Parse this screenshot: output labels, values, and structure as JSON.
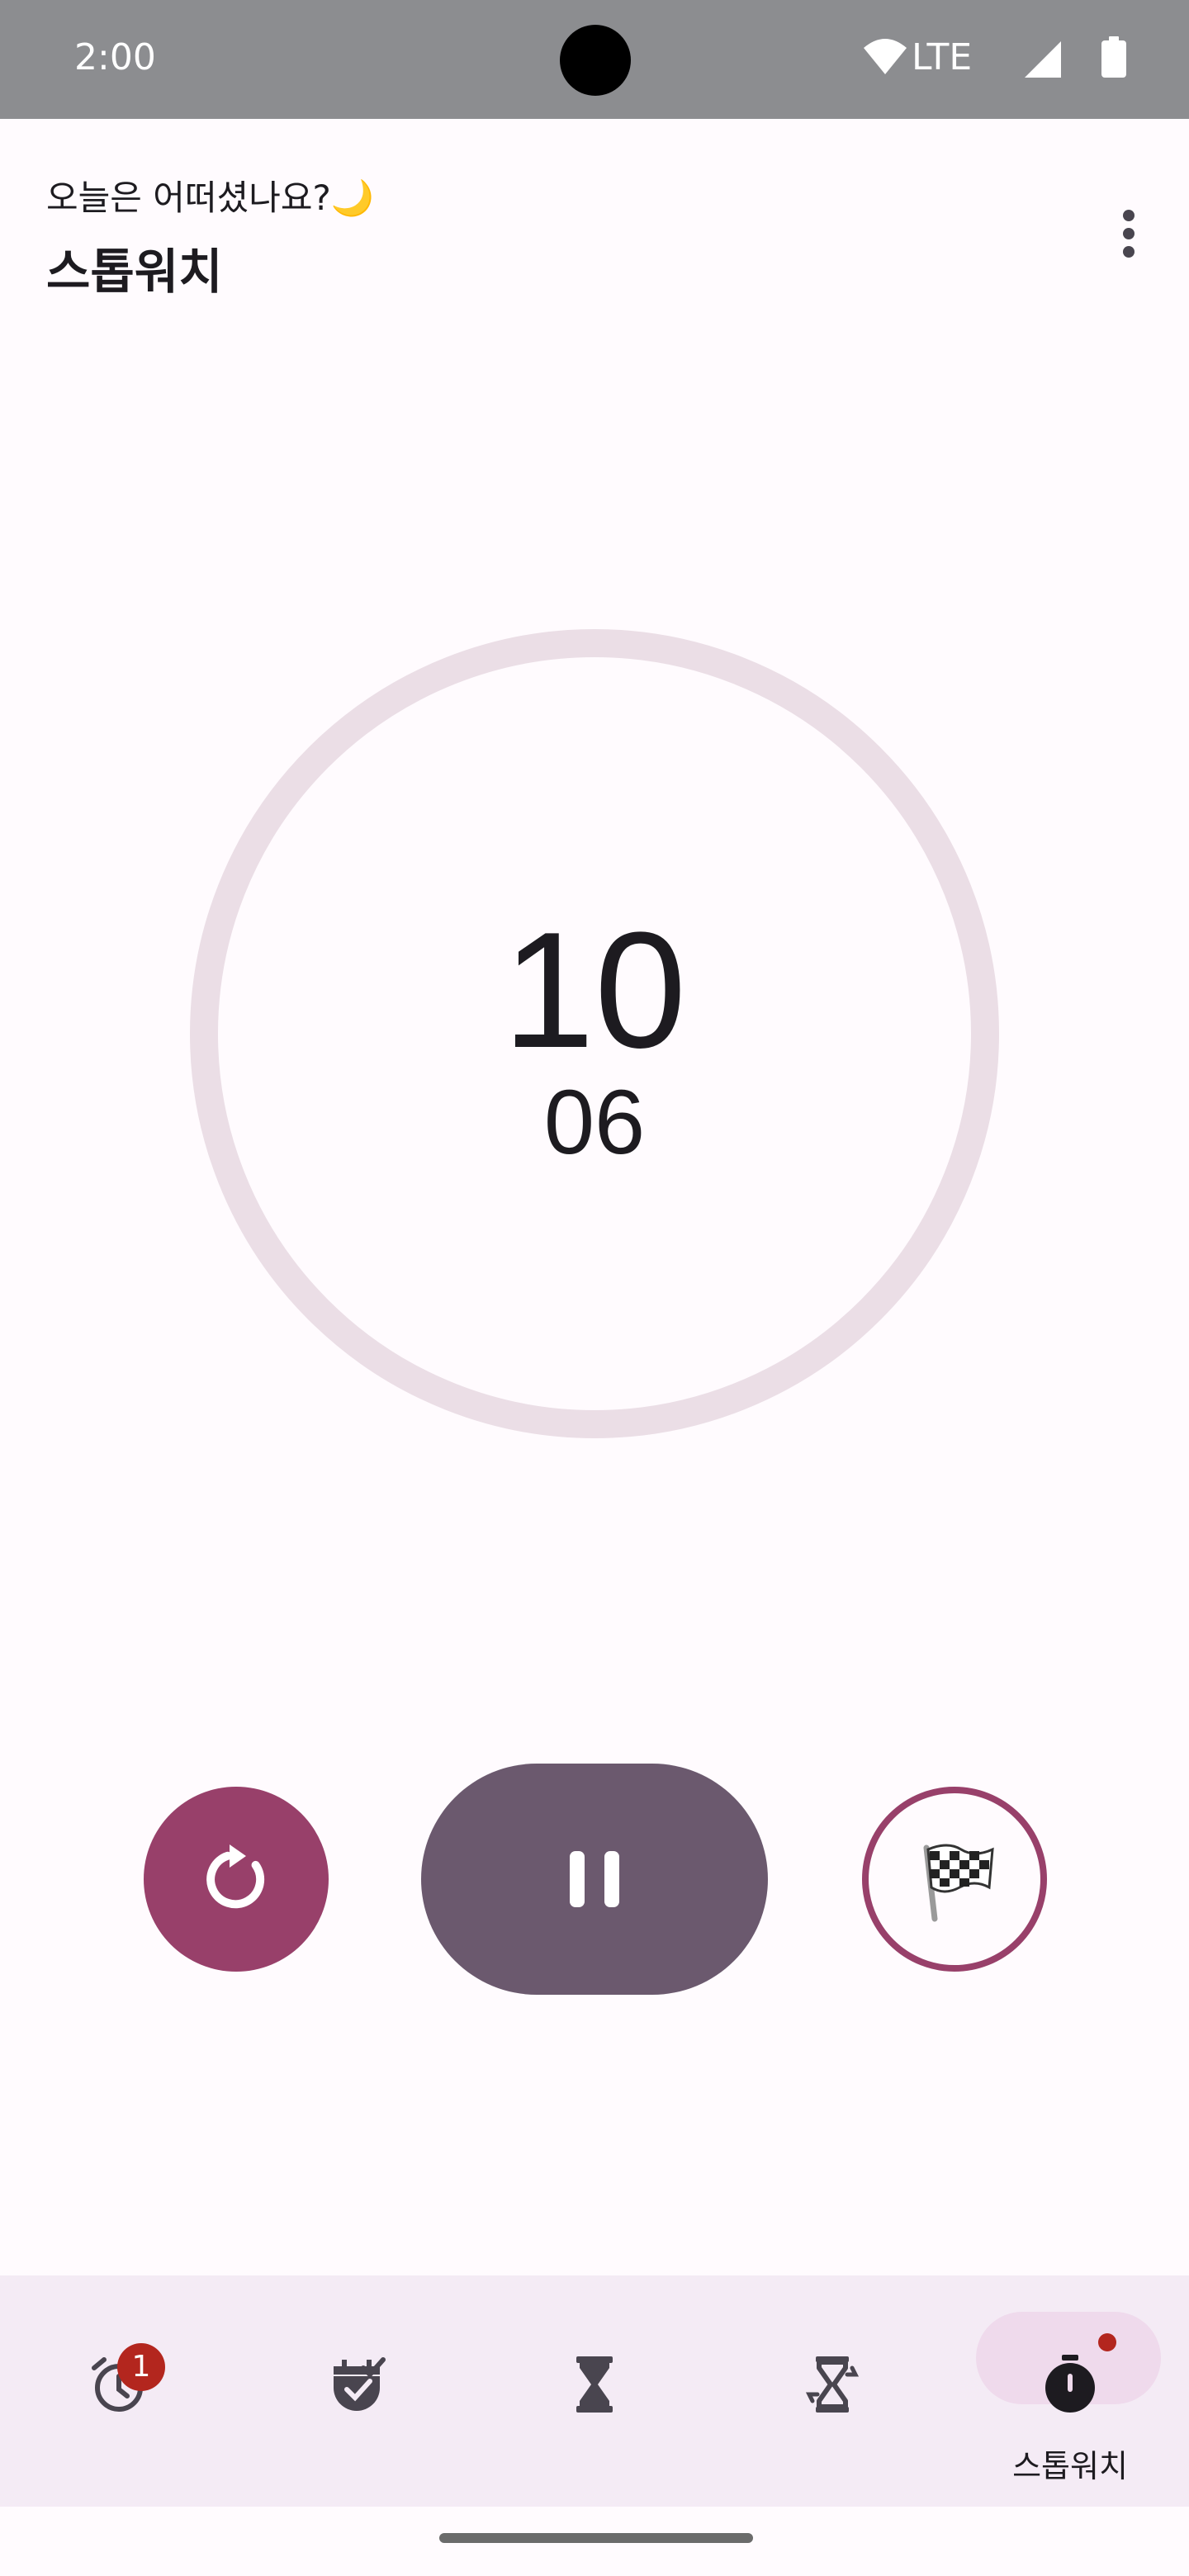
{
  "status_bar": {
    "time": "2:00",
    "network": "LTE",
    "icons": [
      "wifi-icon",
      "signal-icon",
      "battery-icon"
    ]
  },
  "header": {
    "greeting": "오늘은 어떠셨나요?🌙",
    "title": "스톱워치",
    "menu_icon": "more-vert-icon"
  },
  "stopwatch": {
    "main": "10",
    "sub": "06"
  },
  "controls": {
    "reset_icon": "refresh-icon",
    "pause_icon": "pause-icon",
    "lap_icon": "checkered-flag-icon"
  },
  "bottom_nav": {
    "items": [
      {
        "icon": "alarm-icon",
        "badge": "1"
      },
      {
        "icon": "calendar-check-icon"
      },
      {
        "icon": "hourglass-icon"
      },
      {
        "icon": "hourglass-repeat-icon"
      },
      {
        "icon": "stopwatch-icon",
        "label": "스톱워치",
        "active": true
      }
    ]
  },
  "colors": {
    "accent": "#98406A",
    "pause": "#6B596E",
    "ring": "#EBDEE6",
    "nav_bg": "#F4EBF5",
    "badge": "#B3261E"
  }
}
